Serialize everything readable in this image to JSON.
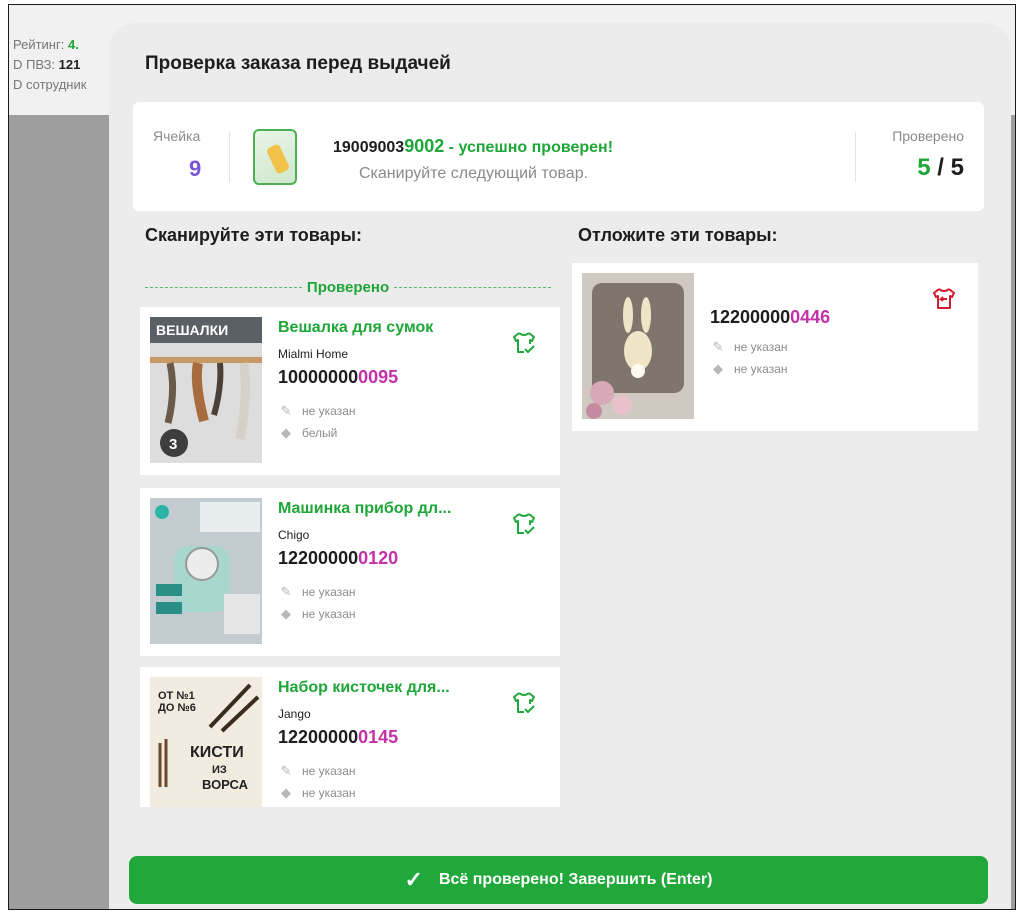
{
  "background": {
    "rating_label": "Рейтинг:",
    "rating_value": "4.",
    "pvz_label": "D ПВЗ:",
    "pvz_value": "121",
    "employee_label": "D сотрудник"
  },
  "modal": {
    "title": "Проверка заказа перед выдачей",
    "status": {
      "cell_label": "Ячейка",
      "cell_number": "9",
      "scanned_code_prefix": "19009003",
      "scanned_code_tail": "9002",
      "scanned_message": " - успешно проверен!",
      "hint": "Сканируйте следующий товар.",
      "checked_label": "Проверено",
      "checked_done": "5",
      "checked_sep": " / ",
      "checked_total": "5"
    },
    "scan_column": {
      "title": "Сканируйте эти товары:",
      "separator_label": "Проверено",
      "items": [
        {
          "name": "Вешалка для сумок",
          "brand": "Mialmi Home",
          "code_prefix": "10000000",
          "code_tail": "0095",
          "size": "не указан",
          "color": "белый",
          "image_text": "ВЕШАЛКИ",
          "image_badge": "3"
        },
        {
          "name": "Машинка прибор дл...",
          "brand": "Chigo",
          "code_prefix": "12200000",
          "code_tail": "0120",
          "size": "не указан",
          "color": "не указан"
        },
        {
          "name": "Набор кисточек для...",
          "brand": "Jango",
          "code_prefix": "12200000",
          "code_tail": "0145",
          "size": "не указан",
          "color": "не указан",
          "image_text_1": "ОТ №1",
          "image_text_2": "ДО №6",
          "image_text_3": "КИСТИ",
          "image_text_4": "ИЗ",
          "image_text_5": "ВОРСА"
        }
      ]
    },
    "setaside_column": {
      "title": "Отложите эти товары:",
      "items": [
        {
          "code_prefix": "12200000",
          "code_tail": "0446",
          "size": "не указан",
          "color": "не указан"
        }
      ]
    },
    "finish_button": "Всё проверено! Завершить (Enter)"
  },
  "colors": {
    "accent_green": "#21a83a",
    "code_tail_magenta": "#c431a8",
    "cell_purple": "#7a55d6",
    "return_red": "#d21a2a"
  },
  "icons": [
    "shirt-check-icon",
    "shirt-return-icon",
    "ruler-icon",
    "paint-drop-icon",
    "checkmark-icon"
  ]
}
